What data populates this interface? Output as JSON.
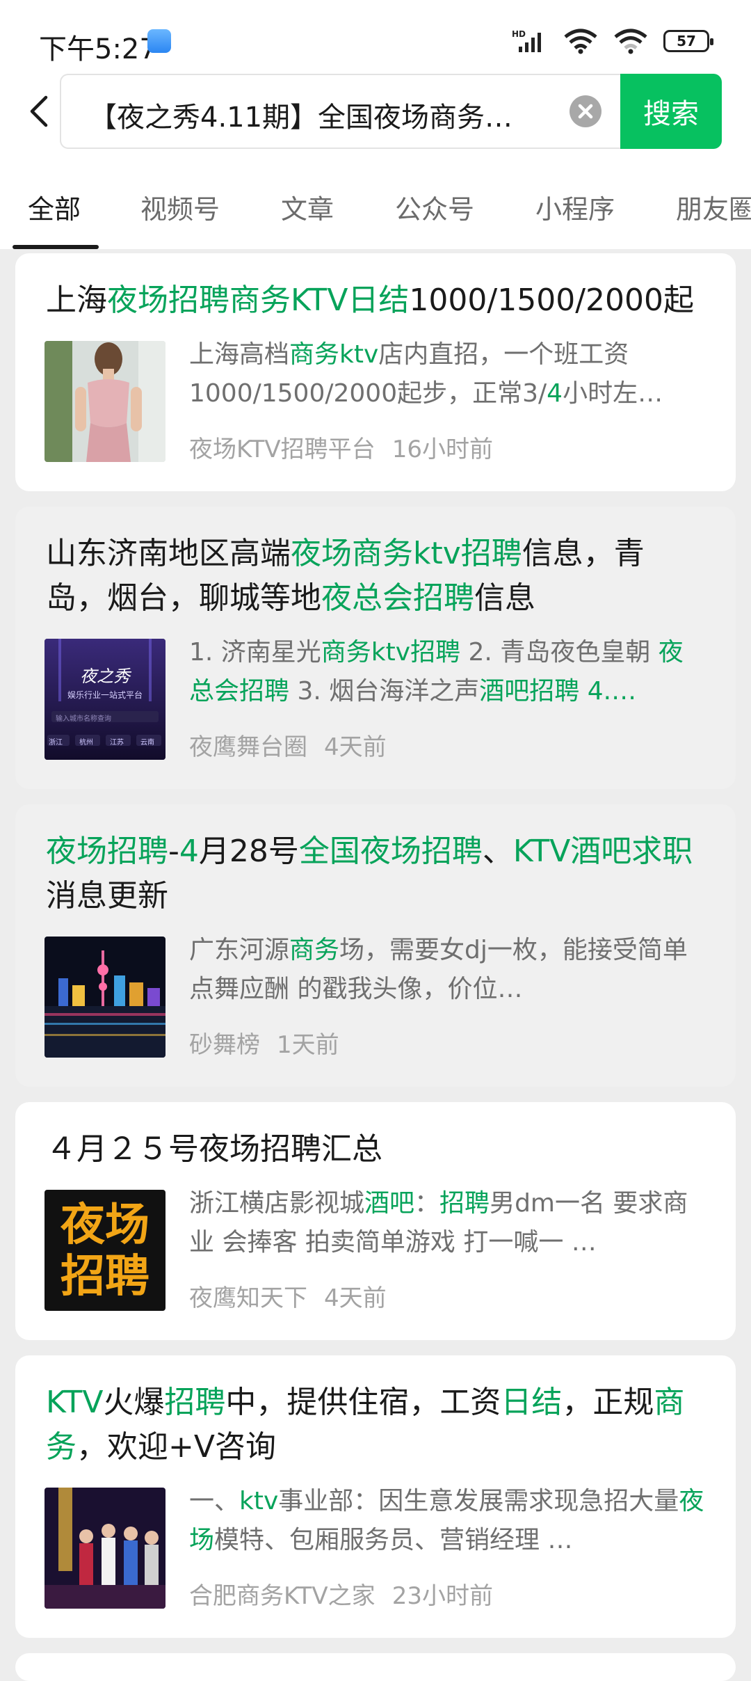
{
  "status_bar": {
    "time": "下午5:27",
    "battery": "57"
  },
  "search": {
    "query": "【夜之秀4.11期】全国夜场商务…",
    "button_label": "搜索"
  },
  "tabs": [
    {
      "label": "全部",
      "active": true
    },
    {
      "label": "视频号"
    },
    {
      "label": "文章"
    },
    {
      "label": "公众号"
    },
    {
      "label": "小程序"
    },
    {
      "label": "朋友圈"
    }
  ],
  "results": [
    {
      "title_parts": [
        {
          "t": "上海",
          "hl": false
        },
        {
          "t": "夜场招聘商务KTV日结",
          "hl": true
        },
        {
          "t": "1000/1500/2000起",
          "hl": false
        }
      ],
      "snippet_parts": [
        {
          "t": "上海高档",
          "hl": false
        },
        {
          "t": "商务ktv",
          "hl": true
        },
        {
          "t": "店内直招，一个班工资1000/1500/2000起步，正常3/",
          "hl": false
        },
        {
          "t": "4",
          "hl": true
        },
        {
          "t": "小时左…",
          "hl": false
        }
      ],
      "source": "夜场KTV招聘平台",
      "time": "16小时前",
      "thumb_icon": "woman-photo"
    },
    {
      "title_parts": [
        {
          "t": "山东济南地区高端",
          "hl": false
        },
        {
          "t": "夜场商务ktv招聘",
          "hl": true
        },
        {
          "t": "信息，青岛，烟台，聊城等地",
          "hl": false
        },
        {
          "t": "夜总会招聘",
          "hl": true
        },
        {
          "t": "信息",
          "hl": false
        }
      ],
      "snippet_parts": [
        {
          "t": "1. 济南星光",
          "hl": false
        },
        {
          "t": "商务ktv招聘",
          "hl": true
        },
        {
          "t": " 2. 青岛夜色皇朝 ",
          "hl": false
        },
        {
          "t": "夜总会招聘",
          "hl": true
        },
        {
          "t": " 3. 烟台海洋之声",
          "hl": false
        },
        {
          "t": "酒吧招聘",
          "hl": true
        },
        {
          "t": " 4.…",
          "hl": true
        }
      ],
      "source": "夜鹰舞台圈",
      "time": "4天前",
      "thumb_icon": "night-show-poster",
      "thumb_text": {
        "logo": "夜之秀",
        "tagline": "娱乐行业一站式平台",
        "search_hint": "输入城市名称查询",
        "cities": [
          "浙江",
          "杭州",
          "江苏",
          "云南"
        ]
      }
    },
    {
      "title_parts": [
        {
          "t": "夜场招聘",
          "hl": true
        },
        {
          "t": "-",
          "hl": false
        },
        {
          "t": "4",
          "hl": true
        },
        {
          "t": "月28号",
          "hl": false
        },
        {
          "t": "全国夜场招聘",
          "hl": true
        },
        {
          "t": "、",
          "hl": false
        },
        {
          "t": "KTV酒吧求职",
          "hl": true
        },
        {
          "t": "消息更新",
          "hl": false
        }
      ],
      "snippet_parts": [
        {
          "t": "广东河源",
          "hl": false
        },
        {
          "t": "商务",
          "hl": true
        },
        {
          "t": "场，需要女dj一枚，能接受简单点舞应酬 的戳我头像，价位…",
          "hl": false
        }
      ],
      "source": "砂舞榜",
      "time": "1天前",
      "thumb_icon": "city-night-photo"
    },
    {
      "title_parts": [
        {
          "t": "４月２５号夜场招聘汇总",
          "hl": false
        }
      ],
      "snippet_parts": [
        {
          "t": "浙江横店影视城",
          "hl": false
        },
        {
          "t": "酒吧",
          "hl": true
        },
        {
          "t": "：",
          "hl": false
        },
        {
          "t": "招聘",
          "hl": true
        },
        {
          "t": "男dm一名 要求商业 会捧客 拍卖简单游戏 打一喊一 …",
          "hl": false
        }
      ],
      "source": "夜鹰知天下",
      "time": "4天前",
      "thumb_icon": "recruit-poster",
      "thumb_text": {
        "line1": "夜场",
        "line2": "招聘"
      }
    },
    {
      "title_parts": [
        {
          "t": "KTV",
          "hl": true
        },
        {
          "t": "火爆",
          "hl": false
        },
        {
          "t": "招聘",
          "hl": true
        },
        {
          "t": "中，提供住宿，工资",
          "hl": false
        },
        {
          "t": "日结",
          "hl": true
        },
        {
          "t": "，正规",
          "hl": false
        },
        {
          "t": "商务",
          "hl": true
        },
        {
          "t": "，欢迎+V咨询",
          "hl": false
        }
      ],
      "snippet_parts": [
        {
          "t": "一、",
          "hl": false
        },
        {
          "t": "ktv",
          "hl": true
        },
        {
          "t": "事业部：因生意发展需求现急招大量",
          "hl": false
        },
        {
          "t": "夜场",
          "hl": true
        },
        {
          "t": "模特、包厢服务员、营销经理 …",
          "hl": false
        }
      ],
      "source": "合肥商务KTV之家",
      "time": "23小时前",
      "thumb_icon": "group-photo"
    }
  ]
}
